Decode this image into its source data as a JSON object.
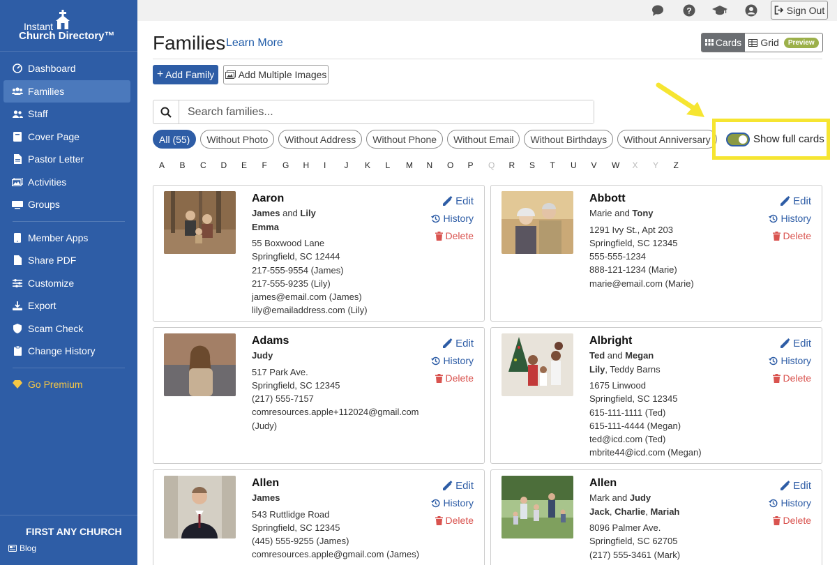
{
  "app": {
    "logo_line1": "Instant",
    "logo_line2": "Church Directory™",
    "church_name": "FIRST ANY CHURCH",
    "blog_label": "Blog"
  },
  "sidebar": {
    "items": [
      {
        "label": "Dashboard",
        "icon": "dashboard-icon"
      },
      {
        "label": "Families",
        "icon": "users-icon",
        "active": true
      },
      {
        "label": "Staff",
        "icon": "staff-icon"
      },
      {
        "label": "Cover Page",
        "icon": "book-icon"
      },
      {
        "label": "Pastor Letter",
        "icon": "document-icon"
      },
      {
        "label": "Activities",
        "icon": "images-icon"
      },
      {
        "label": "Groups",
        "icon": "groups-icon"
      },
      {
        "label": "Member Apps",
        "icon": "mobile-icon"
      },
      {
        "label": "Share PDF",
        "icon": "pdf-icon"
      },
      {
        "label": "Customize",
        "icon": "sliders-icon"
      },
      {
        "label": "Export",
        "icon": "export-icon"
      },
      {
        "label": "Scam Check",
        "icon": "shield-icon"
      },
      {
        "label": "Change History",
        "icon": "clipboard-icon"
      },
      {
        "label": "Go Premium",
        "icon": "diamond-icon"
      }
    ]
  },
  "topbar": {
    "sign_out": "Sign Out"
  },
  "header": {
    "title": "Families",
    "learn_more": "Learn More",
    "view_cards": "Cards",
    "view_grid": "Grid",
    "preview_badge": "Preview",
    "add_family": "Add Family",
    "add_images": "Add Multiple Images"
  },
  "search": {
    "placeholder": "Search families..."
  },
  "filters": [
    "All (55)",
    "Without Photo",
    "Without Address",
    "Without Phone",
    "Without Email",
    "Without Birthdays",
    "Without Anniversary"
  ],
  "toggle": {
    "label": "Show full cards",
    "on": true
  },
  "letters": [
    "A",
    "B",
    "C",
    "D",
    "E",
    "F",
    "G",
    "H",
    "I",
    "J",
    "K",
    "L",
    "M",
    "N",
    "O",
    "P",
    "Q",
    "R",
    "S",
    "T",
    "U",
    "V",
    "W",
    "X",
    "Y",
    "Z"
  ],
  "dim_letters": [
    "Q",
    "X",
    "Y"
  ],
  "actions": {
    "edit": "Edit",
    "history": "History",
    "delete": "Delete"
  },
  "cards": [
    {
      "name": "Aaron",
      "adults": [
        {
          "t": "James",
          "b": true
        },
        {
          "t": " and ",
          "b": false
        },
        {
          "t": "Lily",
          "b": true
        }
      ],
      "kids": [
        {
          "t": "Emma",
          "b": true
        }
      ],
      "lines": [
        "55 Boxwood Lane",
        "Springfield, SC 12444",
        "217-555-9554 (James)",
        "217-555-9235 (Lily)",
        "james@email.com (James)",
        "lily@emailaddress.com (Lily)"
      ]
    },
    {
      "name": "Abbott",
      "adults": [
        {
          "t": "Marie and ",
          "b": false
        },
        {
          "t": "Tony",
          "b": true
        }
      ],
      "kids": [],
      "lines": [
        "1291 Ivy St., Apt 203",
        "Springfield, SC 12345",
        "555-555-1234",
        "888-121-1234 (Marie)",
        "marie@email.com (Marie)"
      ]
    },
    {
      "name": "Adams",
      "adults": [
        {
          "t": "Judy",
          "b": true
        }
      ],
      "kids": [],
      "lines": [
        "517 Park Ave.",
        "Springfield, SC 12345",
        "(217) 555-7157",
        "comresources.apple+112024@gmail.com",
        "(Judy)"
      ]
    },
    {
      "name": "Albright",
      "adults": [
        {
          "t": "Ted",
          "b": true
        },
        {
          "t": " and ",
          "b": false
        },
        {
          "t": "Megan",
          "b": true
        }
      ],
      "kids": [
        {
          "t": "Lily",
          "b": true
        },
        {
          "t": ", Teddy Barns",
          "b": false
        }
      ],
      "lines": [
        "1675 Linwood",
        "Springfield, SC 12345",
        "615-111-1111 (Ted)",
        "615-111-4444 (Megan)",
        "ted@icd.com (Ted)",
        "mbrite44@icd.com (Megan)"
      ]
    },
    {
      "name": "Allen",
      "adults": [
        {
          "t": "James",
          "b": true
        }
      ],
      "kids": [],
      "lines": [
        "543 Ruttlidge Road",
        "Springfield, SC 12345",
        "(445) 555-9255 (James)",
        "comresources.apple@gmail.com (James)"
      ]
    },
    {
      "name": "Allen",
      "adults": [
        {
          "t": "Mark and ",
          "b": false
        },
        {
          "t": "Judy",
          "b": true
        }
      ],
      "kids": [
        {
          "t": "Jack",
          "b": true
        },
        {
          "t": ", ",
          "b": false
        },
        {
          "t": "Charlie",
          "b": true
        },
        {
          "t": ", ",
          "b": false
        },
        {
          "t": "Mariah",
          "b": true
        }
      ],
      "lines": [
        "8096 Palmer Ave.",
        "Springfield, SC 62705",
        "(217) 555-3461 (Mark)"
      ]
    }
  ]
}
